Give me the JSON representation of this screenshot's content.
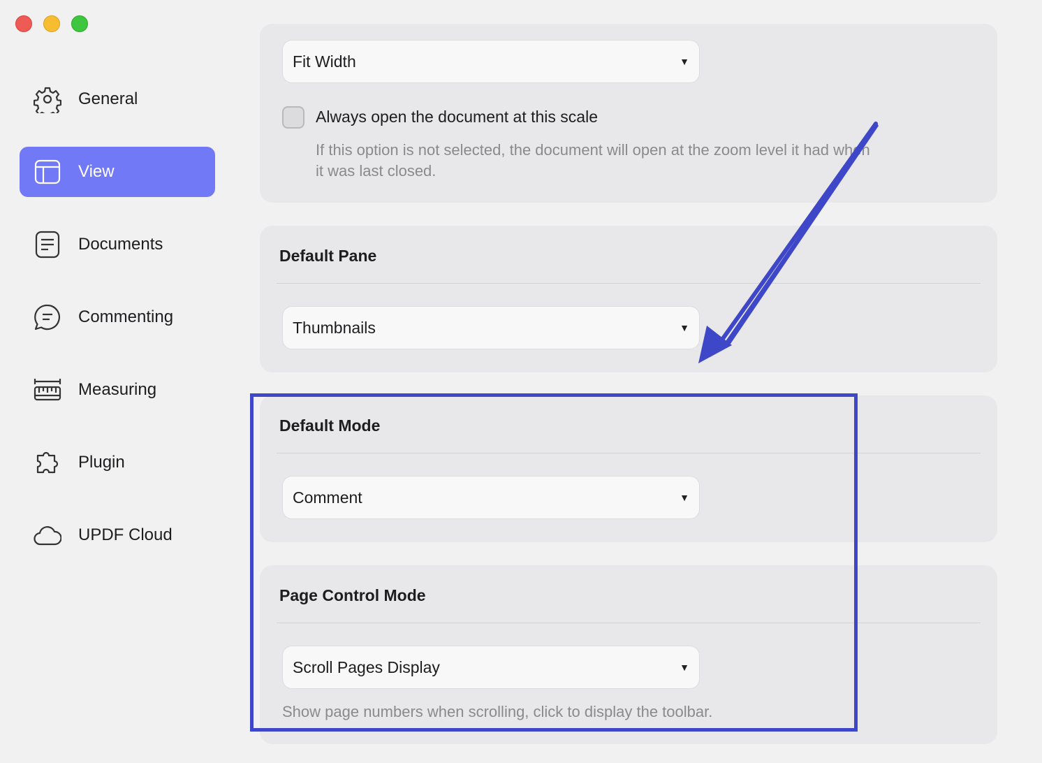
{
  "window": {
    "controls": [
      "close",
      "minimize",
      "zoom"
    ]
  },
  "sidebar": {
    "items": [
      {
        "label": "General",
        "icon": "gear-icon",
        "active": false
      },
      {
        "label": "View",
        "icon": "layout-icon",
        "active": true
      },
      {
        "label": "Documents",
        "icon": "document-icon",
        "active": false
      },
      {
        "label": "Commenting",
        "icon": "comment-icon",
        "active": false
      },
      {
        "label": "Measuring",
        "icon": "ruler-icon",
        "active": false
      },
      {
        "label": "Plugin",
        "icon": "puzzle-icon",
        "active": false
      },
      {
        "label": "UPDF Cloud",
        "icon": "cloud-icon",
        "active": false
      }
    ]
  },
  "zoom_section": {
    "select_value": "Fit Width",
    "checkbox_label": "Always open the document at this scale",
    "checkbox_checked": false,
    "hint_line1": "If this option is not selected, the document will open at the zoom level it had when",
    "hint_line2": "it was last closed."
  },
  "default_pane": {
    "title": "Default Pane",
    "select_value": "Thumbnails"
  },
  "default_mode": {
    "title": "Default Mode",
    "select_value": "Comment"
  },
  "page_control_mode": {
    "title": "Page Control Mode",
    "select_value": "Scroll Pages Display",
    "hint": "Show page numbers when scrolling, click to display the toolbar."
  },
  "colors": {
    "accent": "#7279f6",
    "annotation": "#3f47c9"
  }
}
